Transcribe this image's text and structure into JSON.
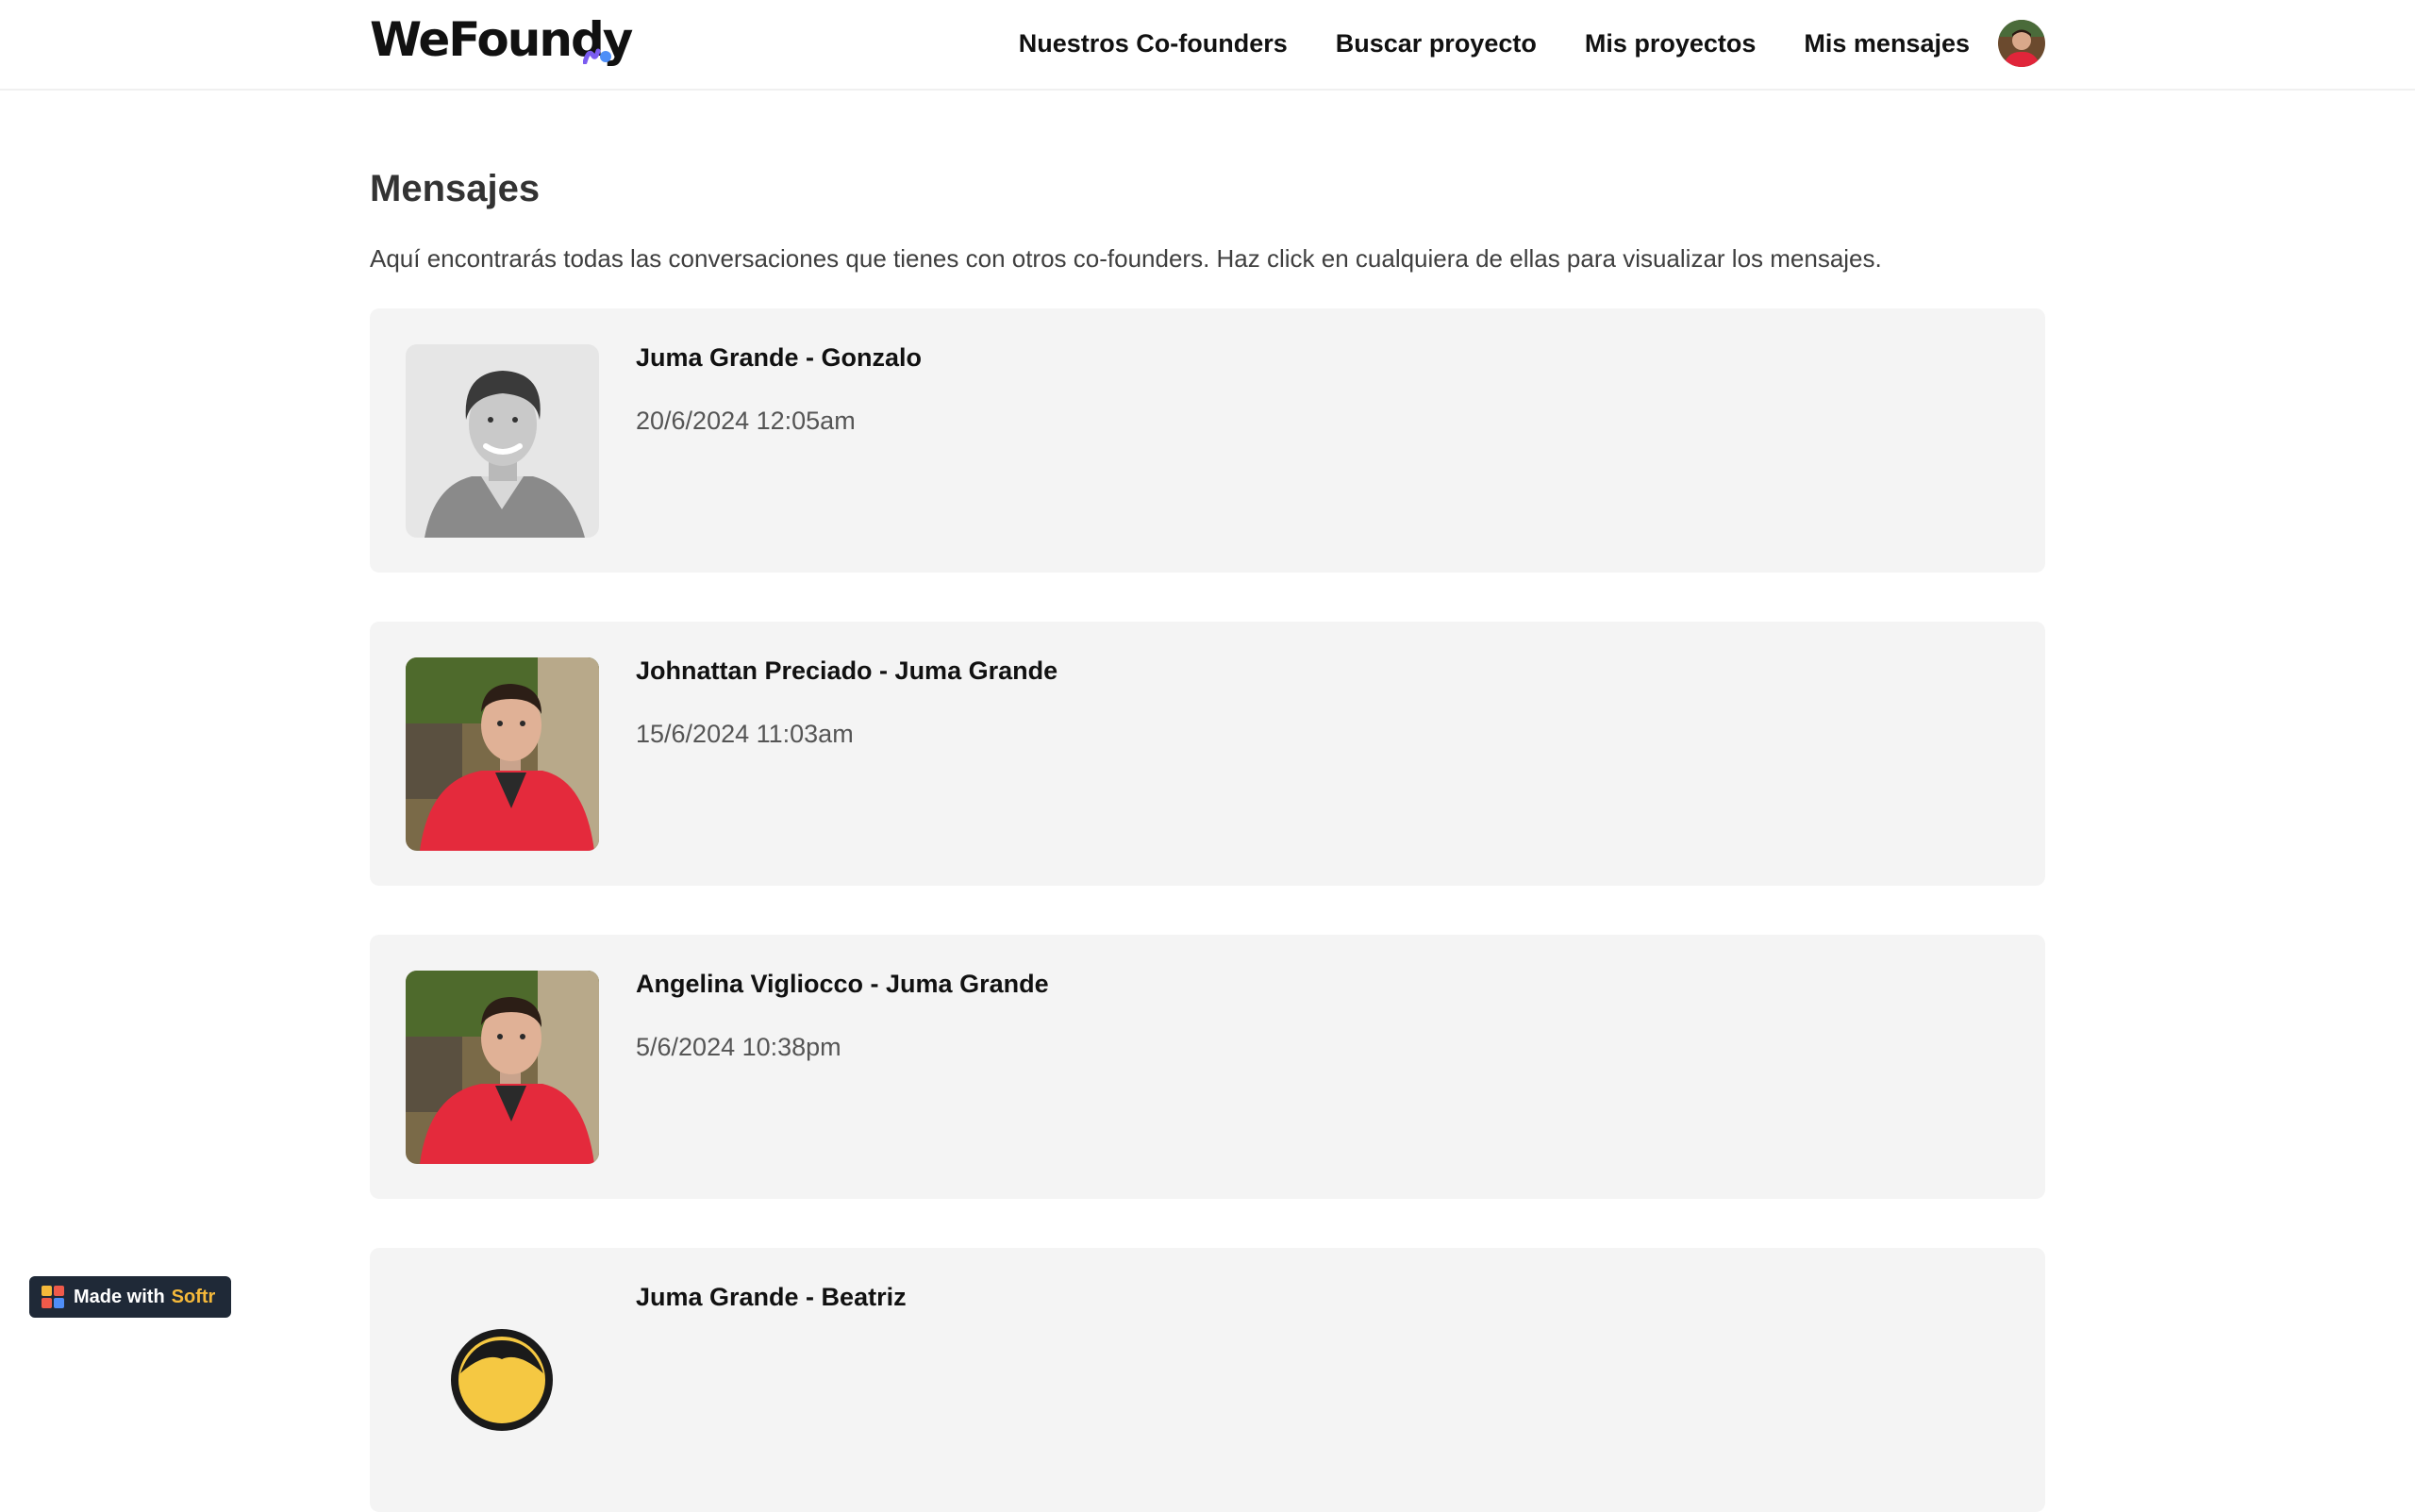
{
  "header": {
    "logo_text": "WeFoundy",
    "nav": [
      {
        "label": "Nuestros Co-founders"
      },
      {
        "label": "Buscar proyecto"
      },
      {
        "label": "Mis proyectos"
      },
      {
        "label": "Mis mensajes"
      }
    ],
    "avatar_icon": "user-avatar-photo"
  },
  "main": {
    "title": "Mensajes",
    "description": "Aquí encontrarás todas las conversaciones que tienes con otros co-founders. Haz click en cualquiera de ellas para visualizar los mensajes.",
    "conversations": [
      {
        "title": "Juma Grande - Gonzalo",
        "date": "20/6/2024 12:05am",
        "photo": "grayscale-portrait-curly-hair"
      },
      {
        "title": "Johnattan Preciado - Juma Grande",
        "date": "15/6/2024 11:03am",
        "photo": "selfie-red-jacket-park"
      },
      {
        "title": "Angelina Vigliocco - Juma Grande",
        "date": "5/6/2024 10:38pm",
        "photo": "selfie-red-jacket-park"
      },
      {
        "title": "Juma Grande - Beatriz",
        "date": "",
        "photo": "illustrated-avatar-yellow-hair"
      }
    ]
  },
  "badge": {
    "made_with": "Made with",
    "brand": "Softr"
  },
  "colors": {
    "card_bg": "#f4f4f4",
    "badge_bg": "#1f2937",
    "badge_accent": "#f5b93a",
    "logo_mark_purple": "#7b5cf0",
    "logo_mark_blue": "#4f8ef7"
  }
}
